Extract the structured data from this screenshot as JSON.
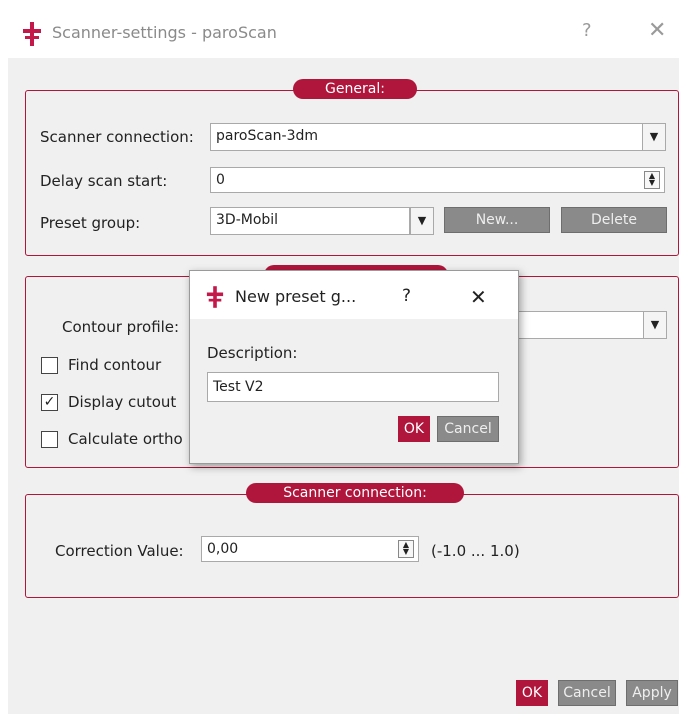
{
  "window": {
    "title": "Scanner-settings - paroScan",
    "help": "?",
    "close": "✕"
  },
  "general": {
    "header": "General:",
    "scanner_connection_label": "Scanner connection:",
    "scanner_connection_value": "paroScan-3dm",
    "delay_label": "Delay scan start:",
    "delay_value": "0",
    "preset_label": "Preset group:",
    "preset_value": "3D-Mobil",
    "new_button": "New...",
    "delete_button": "Delete"
  },
  "contour": {
    "profile_label": "Contour profile:",
    "find_contour": {
      "label": "Find contour",
      "checked": false
    },
    "display_cutout": {
      "label": "Display cutout",
      "checked": true
    },
    "calculate_ortho": {
      "label": "Calculate ortho",
      "checked": false
    }
  },
  "scanner_connection": {
    "header": "Scanner connection:",
    "correction_label": "Correction Value:",
    "correction_value": "0,00",
    "range": "(-1.0 ... 1.0)"
  },
  "footer": {
    "ok": "OK",
    "cancel": "Cancel",
    "apply": "Apply"
  },
  "modal": {
    "title": "New preset g...",
    "help": "?",
    "close": "✕",
    "description_label": "Description:",
    "description_value": "Test V2",
    "ok": "OK",
    "cancel": "Cancel"
  },
  "colors": {
    "accent": "#b0153c",
    "button_grey": "#8a8a8a"
  },
  "icons": {
    "app": "scanner-app-icon",
    "dropdown": "chevron-down-icon",
    "spin": "spinner-arrows-icon"
  }
}
